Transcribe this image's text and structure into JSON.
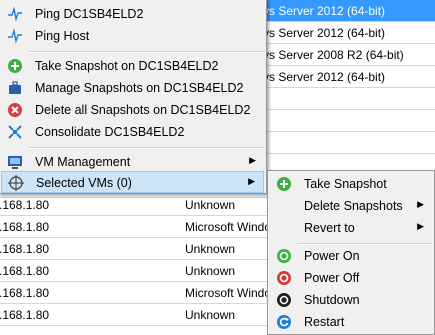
{
  "background": {
    "rows": [
      {
        "ip": "",
        "os": "vs Server 2012 (64-bit)",
        "selected": true
      },
      {
        "ip": "",
        "os": "vs Server 2012 (64-bit)",
        "selected": false
      },
      {
        "ip": "",
        "os": "vs Server 2008 R2 (64-bit)",
        "selected": false
      },
      {
        "ip": "",
        "os": "vs Server 2012 (64-bit)",
        "selected": false
      },
      {
        "ip": "",
        "os": "",
        "selected": false
      },
      {
        "ip": "",
        "os": "",
        "selected": false
      },
      {
        "ip": "",
        "os": "",
        "selected": false
      },
      {
        "ip": "",
        "os": "",
        "selected": false
      },
      {
        "ip": "",
        "os": "",
        "selected": false
      },
      {
        "ip": ".168.1.80",
        "os": "Unknown",
        "selected": false
      },
      {
        "ip": ".168.1.80",
        "os": "Microsoft Window",
        "selected": false
      },
      {
        "ip": ".168.1.80",
        "os": "Unknown",
        "selected": false
      },
      {
        "ip": ".168.1.80",
        "os": "Unknown",
        "selected": false
      },
      {
        "ip": ".168.1.80",
        "os": "Microsoft Window",
        "selected": false
      },
      {
        "ip": ".168.1.80",
        "os": "Unknown",
        "selected": false
      }
    ]
  },
  "context_menu": {
    "items": [
      {
        "label": "Ping DC1SB4ELD2",
        "icon": "pulse-icon"
      },
      {
        "label": "Ping Host",
        "icon": "pulse-icon"
      },
      {
        "label": "Take Snapshot on DC1SB4ELD2",
        "icon": "add-icon"
      },
      {
        "label": "Manage Snapshots on DC1SB4ELD2",
        "icon": "briefcase-icon"
      },
      {
        "label": "Delete all Snapshots on DC1SB4ELD2",
        "icon": "delete-icon"
      },
      {
        "label": "Consolidate DC1SB4ELD2",
        "icon": "consolidate-icon"
      },
      {
        "label": "VM Management",
        "icon": "monitor-icon"
      },
      {
        "label": "Selected VMs (0)",
        "icon": "target-icon"
      }
    ]
  },
  "submenu": {
    "items": [
      {
        "label": "Take Snapshot",
        "icon": "add-icon"
      },
      {
        "label": "Delete Snapshots",
        "icon": ""
      },
      {
        "label": "Revert to",
        "icon": ""
      },
      {
        "label": "Power On",
        "icon": "power-on-icon"
      },
      {
        "label": "Power Off",
        "icon": "power-off-icon"
      },
      {
        "label": "Shutdown",
        "icon": "shutdown-icon"
      },
      {
        "label": "Restart",
        "icon": "restart-icon"
      }
    ]
  },
  "colors": {
    "row_selected": "#3399ff",
    "menu_bg": "#f0f0f0",
    "highlight": "#cce4f7",
    "green": "#3cb043",
    "red": "#d83b3b",
    "blue": "#1e7fd6"
  }
}
